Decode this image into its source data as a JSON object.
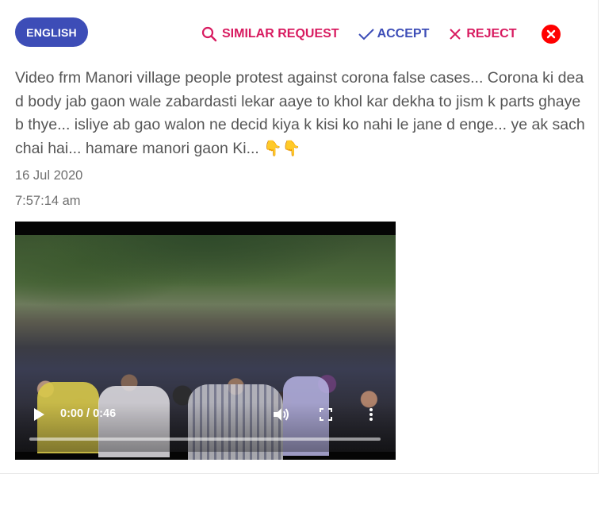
{
  "language": {
    "label": "ENGLISH"
  },
  "actions": {
    "similar_label": "SIMILAR REQUEST",
    "accept_label": "ACCEPT",
    "reject_label": "REJECT"
  },
  "message": {
    "text": "Video frm Manori village people protest against corona false cases... Corona ki dead body jab gaon wale zabardasti lekar aaye to khol kar dekha to jism k parts ghayeb thye... isliye ab gao walon ne decid kiya k kisi ko nahi le jane d enge... ye ak sachchai hai... hamare manori gaon Ki...",
    "emoji": "👇👇"
  },
  "meta": {
    "date": "16 Jul 2020",
    "time": "7:57:14 am"
  },
  "video": {
    "time_display": "0:00 / 0:46",
    "progress": 0
  },
  "colors": {
    "primary": "#3d4db7",
    "danger": "#d81b60",
    "close": "#ff0000",
    "text": "#555555"
  }
}
